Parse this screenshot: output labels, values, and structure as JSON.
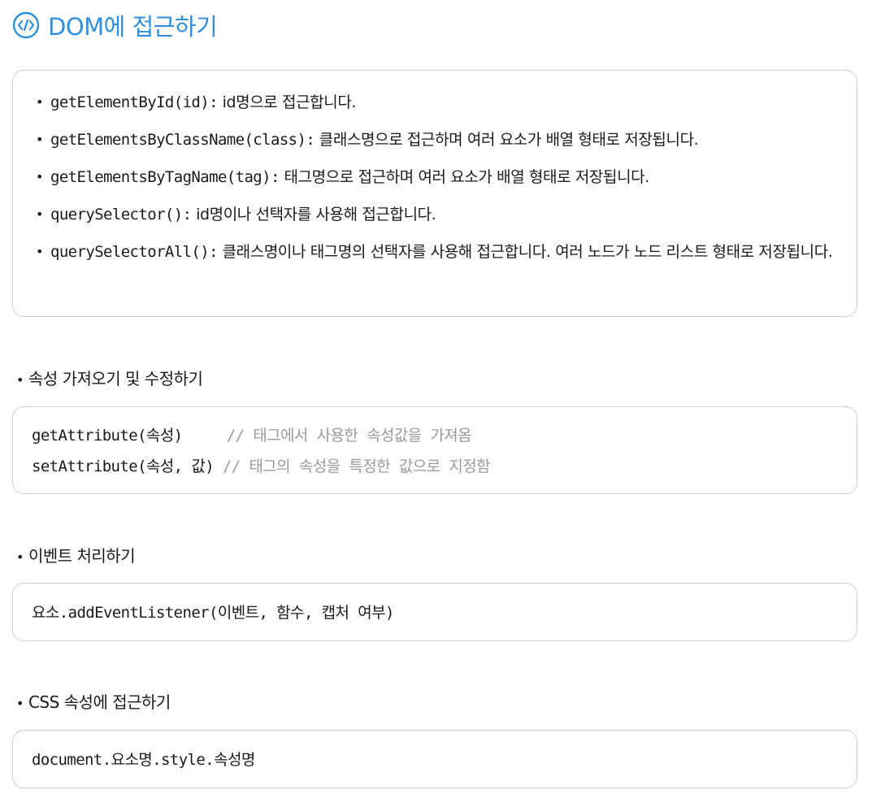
{
  "title": "DOM에 접근하기",
  "dom_methods": [
    {
      "code": "getElementById(id):",
      "desc": " id명으로 접근합니다."
    },
    {
      "code": "getElementsByClassName(class):",
      "desc": " 클래스명으로 접근하며 여러 요소가 배열 형태로 저장됩니다."
    },
    {
      "code": "getElementsByTagName(tag):",
      "desc": " 태그명으로 접근하며 여러 요소가 배열 형태로 저장됩니다."
    },
    {
      "code": "querySelector():",
      "desc": " id명이나 선택자를 사용해 접근합니다."
    },
    {
      "code": "querySelectorAll():",
      "desc": " 클래스명이나 태그명의 선택자를 사용해 접근합니다. 여러 노드가 노드 리스트 형태로 저장됩니다."
    }
  ],
  "attr_section": {
    "heading": "속성 가져오기 및 수정하기",
    "lines": [
      {
        "code": "getAttribute(속성)     ",
        "comment": "// 태그에서 사용한 속성값을 가져옴"
      },
      {
        "code": "setAttribute(속성, 값) ",
        "comment": "// 태그의 속성을 특정한 값으로 지정함"
      }
    ]
  },
  "event_section": {
    "heading": "이벤트 처리하기",
    "code": "요소.addEventListener(이벤트, 함수, 캡처 여부)"
  },
  "css_section": {
    "heading": "CSS 속성에 접근하기",
    "code": "document.요소명.style.속성명"
  },
  "colors": {
    "accent": "#2f8fe0",
    "comment": "#9a9a9a",
    "border": "#cfcfcf"
  },
  "icons": {
    "title_icon": "code-circle-icon"
  }
}
